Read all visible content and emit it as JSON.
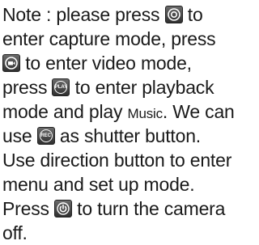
{
  "note": {
    "line1_a": "Note : please press ",
    "line1_b": " to",
    "line2": "enter capture mode, press",
    "line3_b": " to enter video mode,",
    "line4_a": "press ",
    "line4_b": " to enter playback",
    "line5_a": "mode and play ",
    "line5_small": "Music",
    "line5_b": ". We can",
    "line6_a": "use ",
    "line6_b": " as shutter button.",
    "line7": "Use direction button to enter",
    "line8": "menu and set up mode.",
    "line9_a": "Press ",
    "line9_b": " to turn the camera",
    "line10": "off."
  },
  "icons": {
    "capture": "camera-capture-icon",
    "video": "video-mode-icon",
    "playback": "play-icon",
    "playback_label": "PLAY",
    "shutter": "rec-icon",
    "shutter_label": "REC",
    "power": "power-icon"
  },
  "colors": {
    "text": "#1a1a1a",
    "icon_bg": "#3f3f3f"
  }
}
